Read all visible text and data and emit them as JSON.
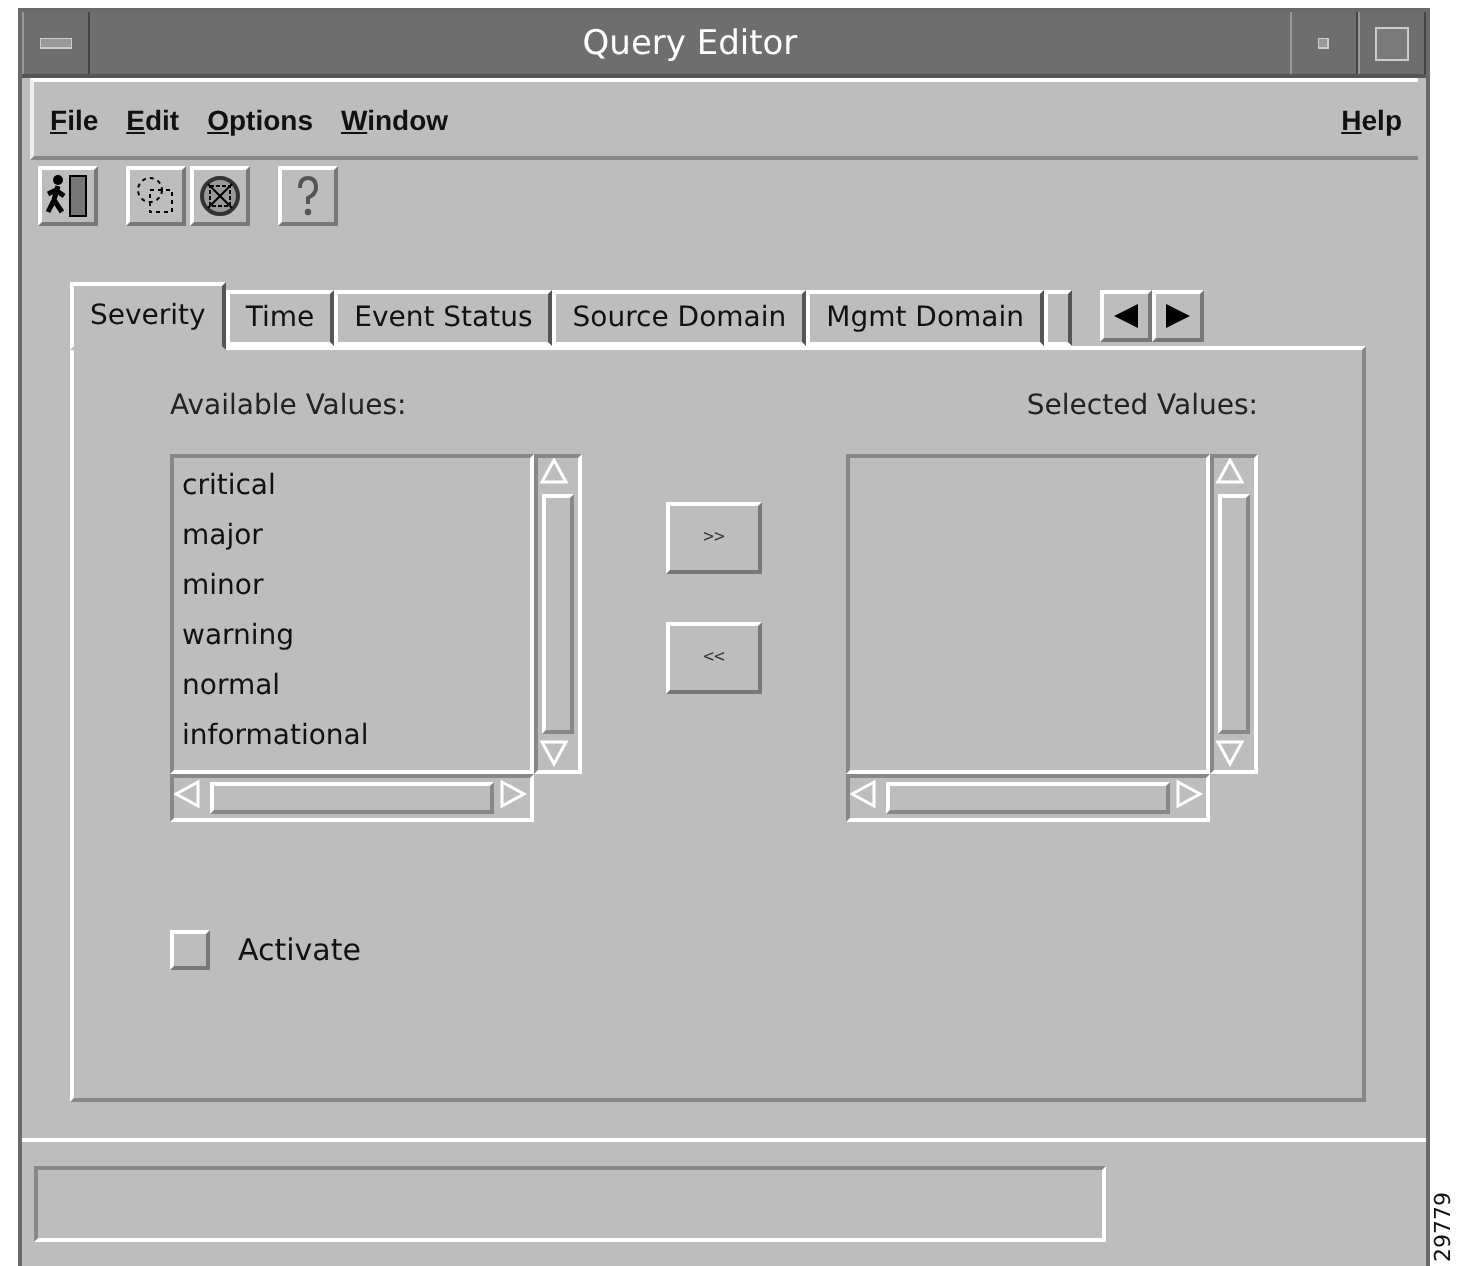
{
  "window": {
    "title": "Query Editor"
  },
  "menu": [
    {
      "label": "File"
    },
    {
      "label": "Edit"
    },
    {
      "label": "Options"
    },
    {
      "label": "Window"
    }
  ],
  "help_menu": {
    "label": "Help"
  },
  "tabs": [
    {
      "label": "Severity",
      "selected": true
    },
    {
      "label": "Time",
      "selected": false
    },
    {
      "label": "Event Status",
      "selected": false
    },
    {
      "label": "Source Domain",
      "selected": false
    },
    {
      "label": "Mgmt Domain",
      "selected": false
    }
  ],
  "available": {
    "label": "Available Values:",
    "items": [
      "critical",
      "major",
      "minor",
      "warning",
      "normal",
      "informational"
    ]
  },
  "selected_values": {
    "label": "Selected Values:"
  },
  "move_buttons": [
    ">>",
    "<<"
  ],
  "activate": {
    "label": "Activate",
    "checked": false
  },
  "figure_id": "29779"
}
